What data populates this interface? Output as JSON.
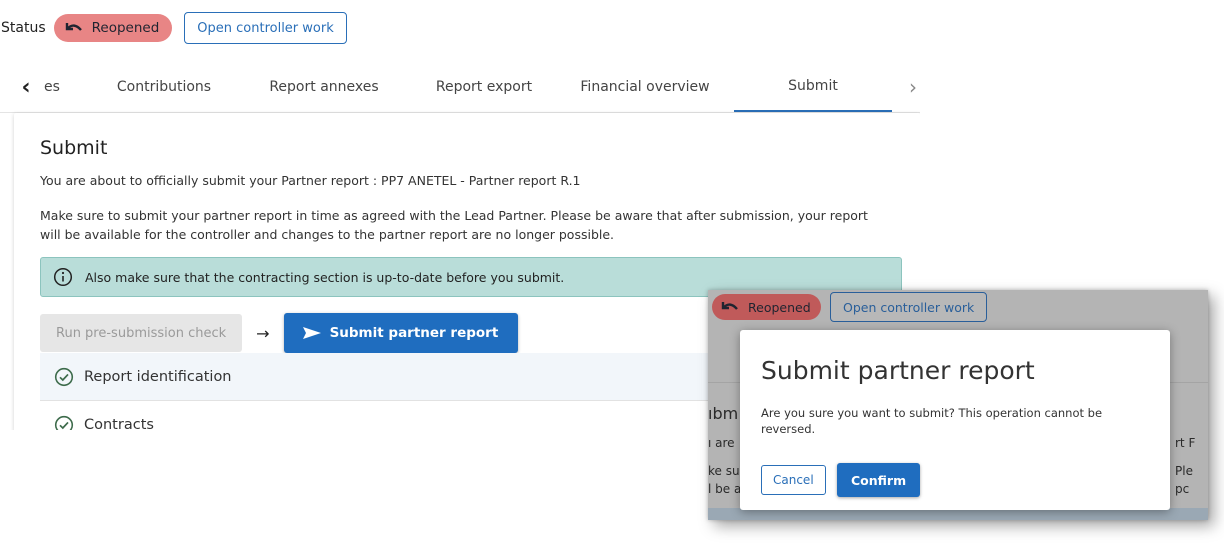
{
  "status": {
    "label": "Status",
    "badge": "Reopened",
    "open_controller_work": "Open controller work"
  },
  "tabs": {
    "items": [
      {
        "label": "es"
      },
      {
        "label": "Contributions"
      },
      {
        "label": "Report annexes"
      },
      {
        "label": "Report export"
      },
      {
        "label": "Financial overview"
      },
      {
        "label": "Submit",
        "active": true
      }
    ],
    "prev_icon": "chevron-left-icon",
    "next_icon": "chevron-right-icon"
  },
  "submit_section": {
    "title": "Submit",
    "intro": "You are about to officially submit your Partner report : PP7 ANETEL - Partner report R.1",
    "note_line1": "Make sure to submit your partner report in time as agreed with the Lead Partner. Please be aware that after submission, your report",
    "note_line2": "will be available for the controller and changes to the partner report are no longer possible.",
    "info_message": "Also make sure that the contracting section is up-to-date before you submit.",
    "info_icon": "info-circle-icon",
    "run_check_label": "Run pre-submission check",
    "arrow_symbol": "→",
    "submit_label": "Submit partner report",
    "submit_icon": "send-icon",
    "checks": [
      {
        "label": "Report identification",
        "icon": "check-circle-icon"
      },
      {
        "label": "Contracts",
        "icon": "check-circle-icon"
      }
    ]
  },
  "overlay": {
    "badge": "Reopened",
    "open_controller_work": "Open controller work",
    "bg_texts": [
      "ıbm",
      "ı are",
      "ke su",
      "l be a",
      "rt F",
      "Ple",
      "pc"
    ],
    "modal": {
      "title": "Submit partner report",
      "body": "Are you sure you want to submit? This operation cannot be reversed.",
      "cancel_label": "Cancel",
      "confirm_label": "Confirm"
    }
  },
  "colors": {
    "primary": "#1f6dbf",
    "reopened_badge": "#e88585",
    "info_background": "#b9ddd9"
  }
}
